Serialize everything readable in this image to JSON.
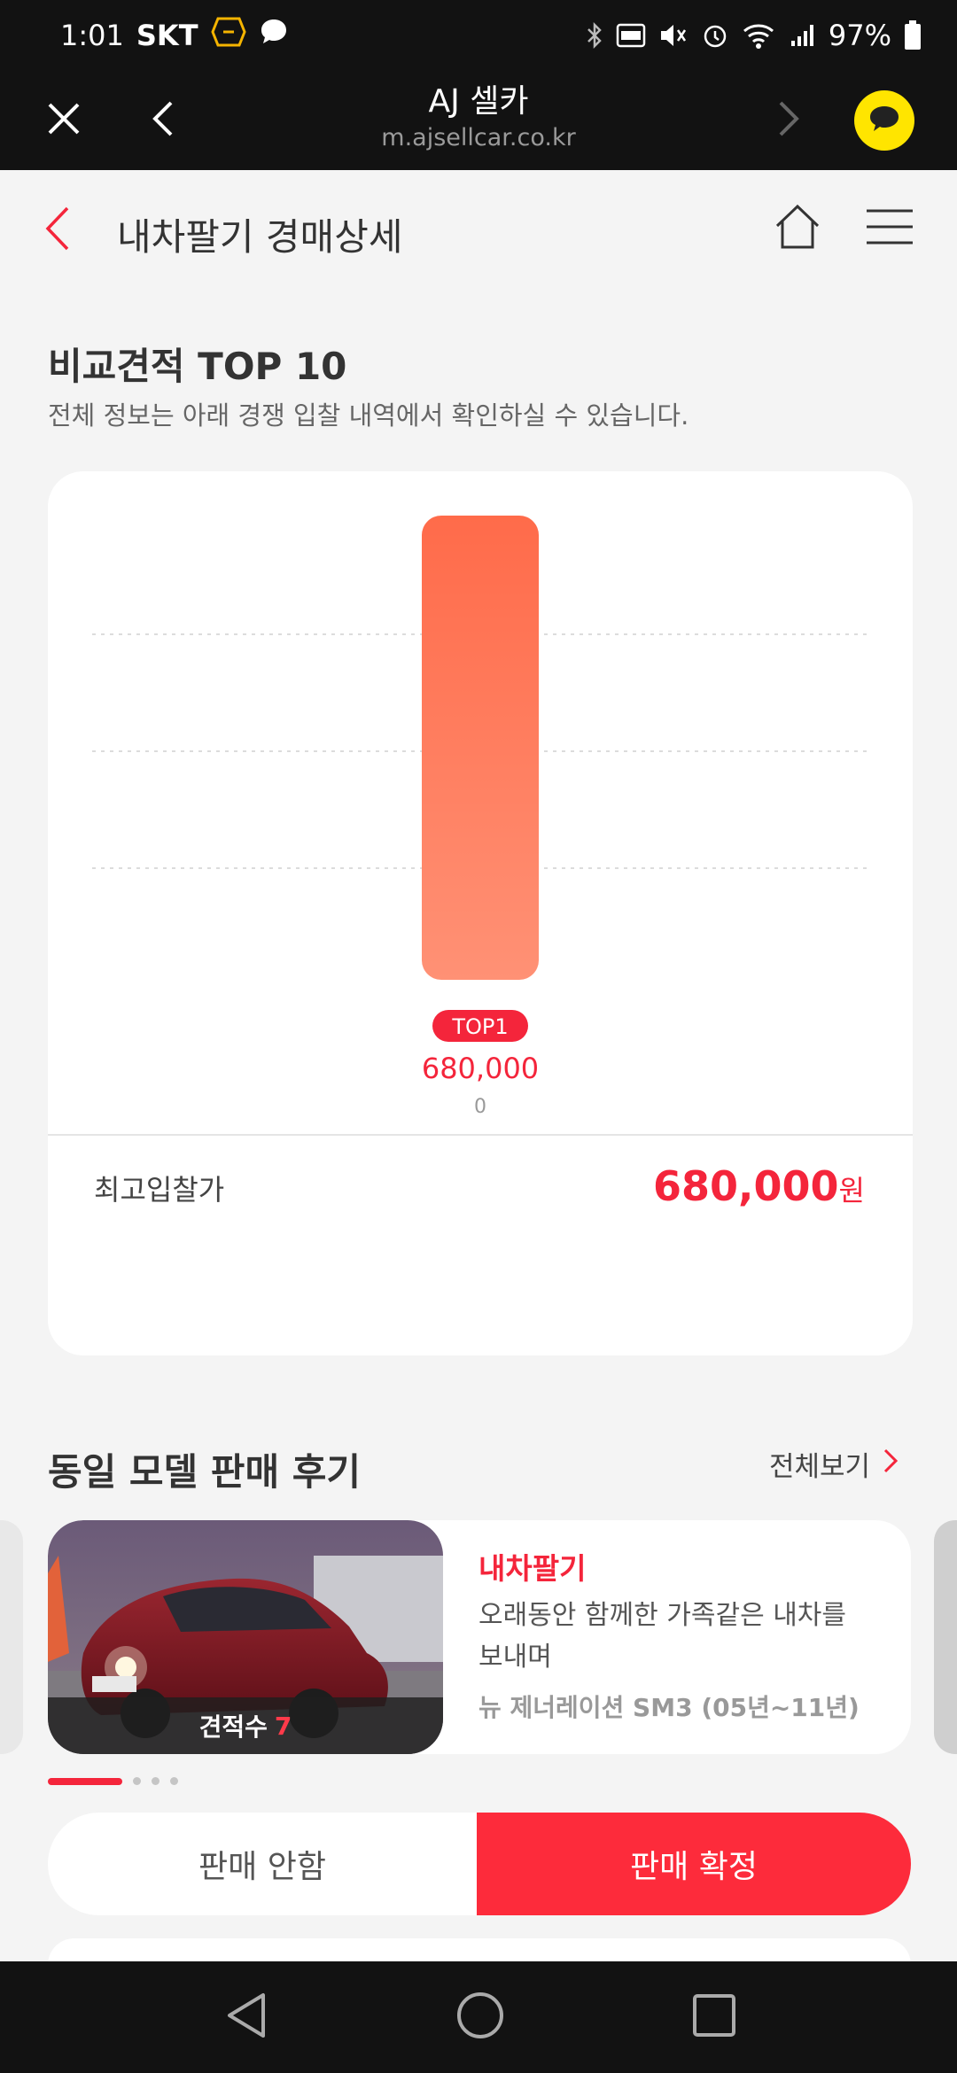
{
  "status_bar": {
    "time": "1:01",
    "carrier": "SKT",
    "battery": "97%"
  },
  "browser": {
    "title": "AJ 셀카",
    "url": "m.ajsellcar.co.kr"
  },
  "header": {
    "title": "내차팔기 경매상세"
  },
  "comparison": {
    "title": "비교견적 TOP 10",
    "subtitle": "전체 정보는 아래 경쟁 입찰 내역에서 확인하실 수 있습니다.",
    "highest_bid_label": "최고입찰가",
    "highest_bid_value": "680,000",
    "currency_unit": "원"
  },
  "chart_data": {
    "type": "bar",
    "categories": [
      "TOP1"
    ],
    "values": [
      680000
    ],
    "value_labels": [
      "680,000"
    ],
    "secondary_labels": [
      "0"
    ],
    "grid": true,
    "bar_color_top": "#ff6b4a",
    "bar_color_bottom": "#ff9175",
    "badge_color": "#f4253b"
  },
  "reviews": {
    "title": "동일 모델 판매 후기",
    "view_all": "전체보기",
    "items": [
      {
        "category": "내차팔기",
        "text": "오래동안 함께한 가족같은 내차를 보내며",
        "model": "뉴 제너레이션 SM3 (05년~11년)",
        "estimate_label": "견적수",
        "estimate_count": "7"
      }
    ]
  },
  "actions": {
    "cancel_label": "판매 안함",
    "confirm_label": "판매 확정"
  },
  "colors": {
    "accent": "#f4253b",
    "talk_yellow": "#ffe500",
    "dark_bar": "#121212"
  }
}
